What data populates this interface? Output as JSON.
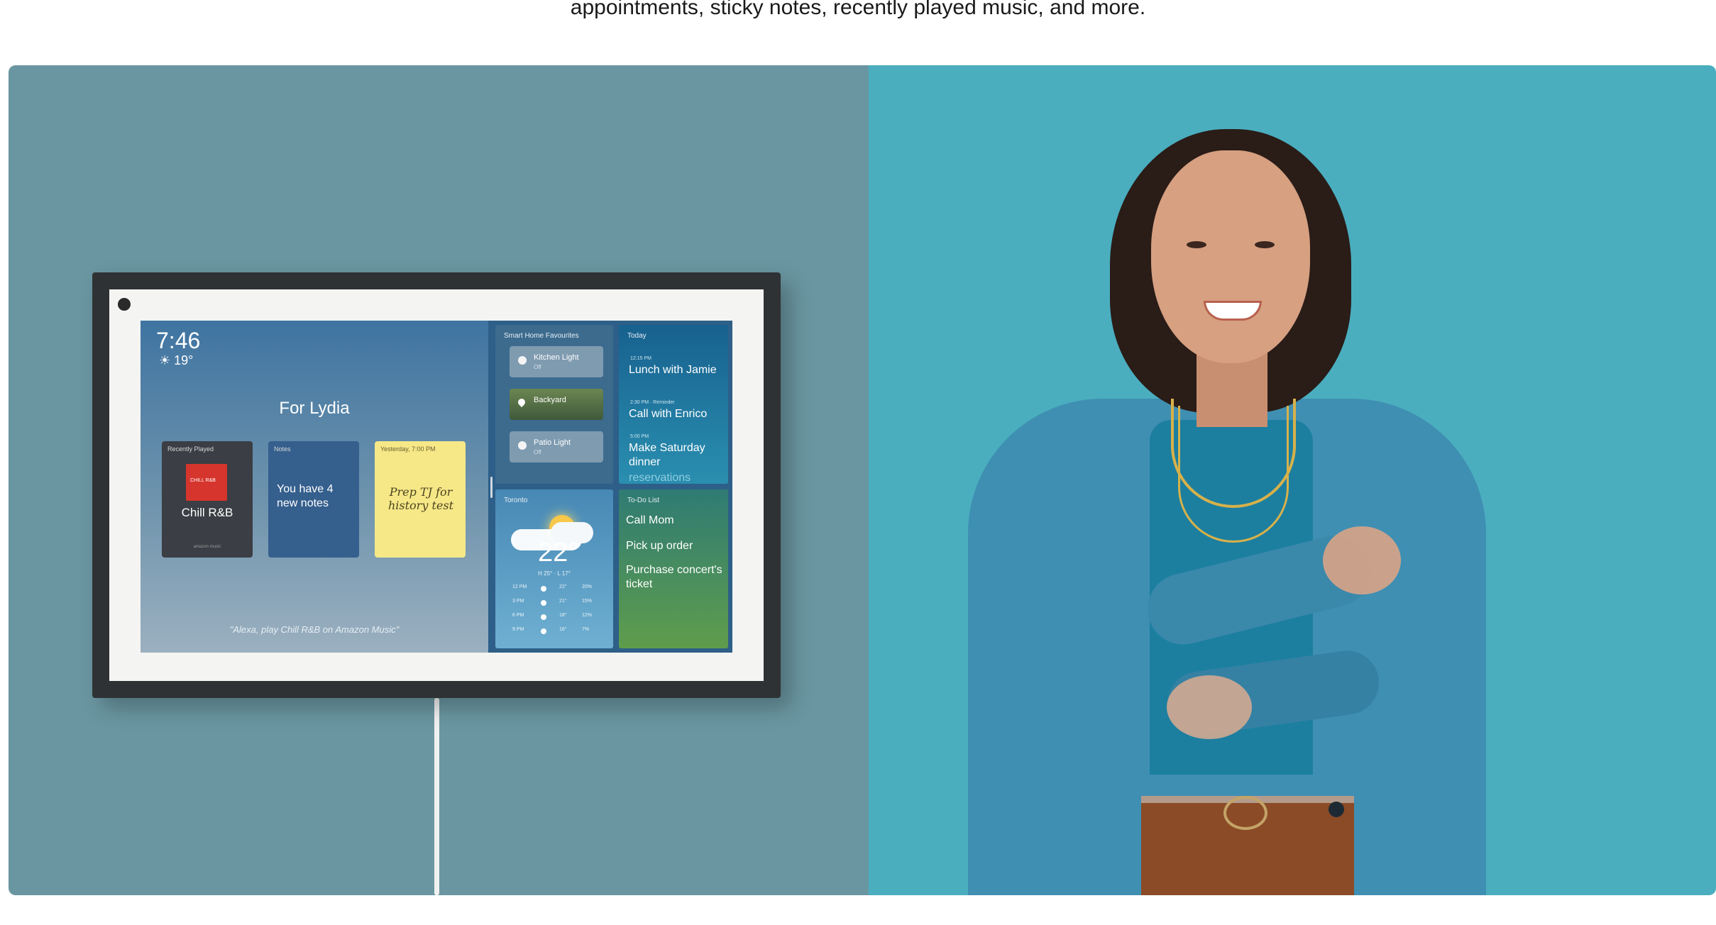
{
  "caption": "appointments, sticky notes, recently played music, and more.",
  "device": {
    "clock": "7:46",
    "temperature": "☀ 19°",
    "greeting": "For Lydia",
    "cards": {
      "music": {
        "label": "Recently Played",
        "album_tag": "CHILL R&B",
        "title": "Chill R&B",
        "brand": "amazon music"
      },
      "notes": {
        "label": "Notes",
        "text": "You have 4 new notes"
      },
      "sticky": {
        "label": "Yesterday, 7:00 PM",
        "text": "Prep TJ for history test"
      }
    },
    "voice_hint": "\"Alexa, play Chill R&B on Amazon Music\"",
    "smart_home": {
      "label": "Smart Home Favourites",
      "items": [
        {
          "name": "Kitchen Light",
          "state": "Off"
        },
        {
          "name": "Backyard",
          "state": ""
        },
        {
          "name": "Patio Light",
          "state": "Off"
        }
      ]
    },
    "today": {
      "label": "Today",
      "events": [
        {
          "time": "12:15 PM",
          "title": "Lunch with Jamie"
        },
        {
          "time": "2:30 PM · Reminder",
          "title": "Call with Enrico"
        },
        {
          "time": "5:00 PM",
          "title": "Make Saturday dinner",
          "extra": "reservations"
        }
      ]
    },
    "weather": {
      "label": "Toronto",
      "temp": "22°",
      "range": "H 25° · L 17°",
      "forecast": [
        {
          "time": "12 PM",
          "temp": "22°",
          "pct": "20%"
        },
        {
          "time": "3 PM",
          "temp": "21°",
          "pct": "15%"
        },
        {
          "time": "6 PM",
          "temp": "18°",
          "pct": "12%"
        },
        {
          "time": "9 PM",
          "temp": "16°",
          "pct": "7%"
        }
      ]
    },
    "todo": {
      "label": "To-Do List",
      "items": [
        "Call Mom",
        "Pick up order",
        "Purchase concert's ticket"
      ]
    }
  }
}
